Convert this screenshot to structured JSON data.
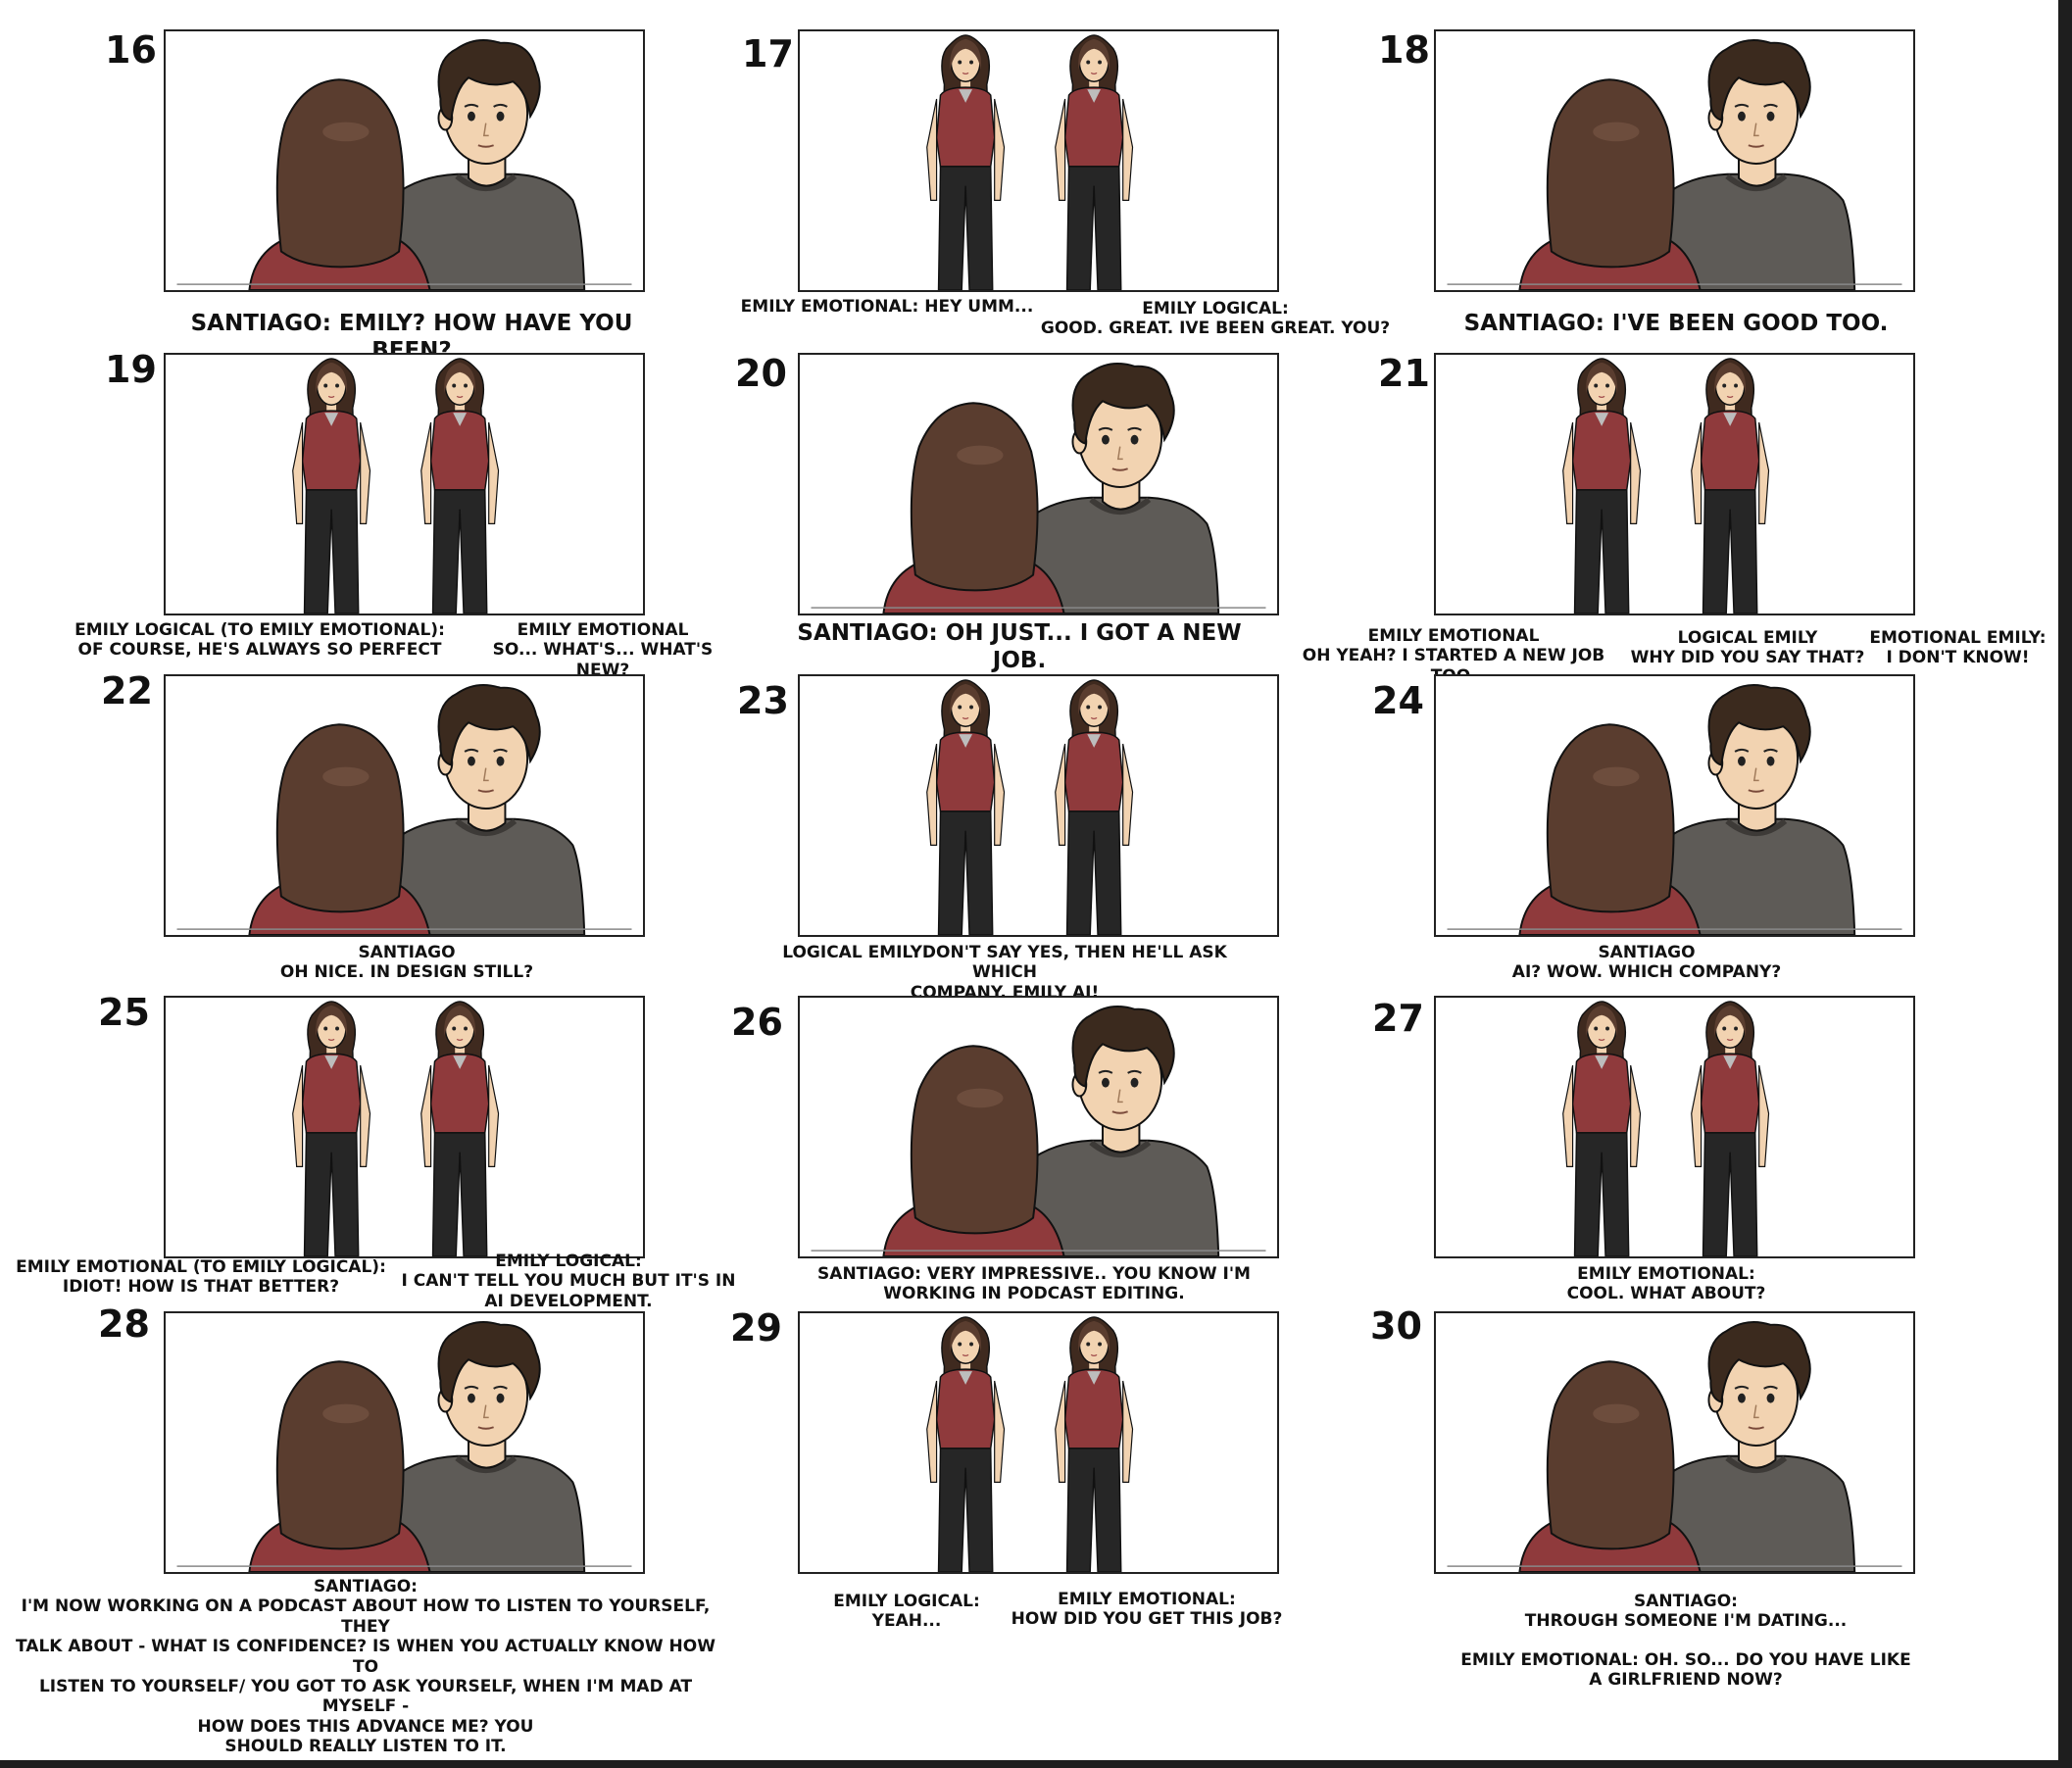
{
  "panels": [
    {
      "number": "16",
      "scene": "over-shoulder",
      "captions": [
        "SANTIAGO: EMILY? HOW HAVE YOU BEEN?"
      ]
    },
    {
      "number": "17",
      "scene": "two-emilys",
      "captions": [
        "EMILY EMOTIONAL: HEY UMM...",
        "EMILY LOGICAL:\nGOOD. GREAT. IVE BEEN GREAT. YOU?"
      ]
    },
    {
      "number": "18",
      "scene": "over-shoulder",
      "captions": [
        "SANTIAGO: I'VE BEEN GOOD TOO."
      ]
    },
    {
      "number": "19",
      "scene": "two-emilys",
      "captions": [
        "EMILY LOGICAL (TO EMILY EMOTIONAL):\nOF COURSE, HE'S ALWAYS SO PERFECT",
        "EMILY EMOTIONAL\nSO... WHAT'S... WHAT'S NEW?"
      ]
    },
    {
      "number": "20",
      "scene": "over-shoulder",
      "captions": [
        "SANTIAGO: OH JUST... I GOT A NEW\nJOB."
      ]
    },
    {
      "number": "21",
      "scene": "two-emilys",
      "captions": [
        "EMILY EMOTIONAL\nOH YEAH? I STARTED A NEW JOB TOO.",
        "LOGICAL EMILY\nWHY DID YOU SAY THAT?",
        "EMOTIONAL EMILY:\nI DON'T KNOW!"
      ]
    },
    {
      "number": "22",
      "scene": "over-shoulder",
      "captions": [
        "SANTIAGO\nOH NICE. IN DESIGN STILL?"
      ]
    },
    {
      "number": "23",
      "scene": "two-emilys",
      "captions": [
        "LOGICAL EMILYDON'T SAY YES, THEN HE'LL ASK WHICH\nCOMPANY.          EMILY AI!"
      ]
    },
    {
      "number": "24",
      "scene": "over-shoulder",
      "captions": [
        "SANTIAGO\nAI? WOW. WHICH COMPANY?"
      ]
    },
    {
      "number": "25",
      "scene": "two-emilys",
      "captions": [
        "EMILY EMOTIONAL (TO EMILY LOGICAL):\nIDIOT! HOW IS THAT BETTER?",
        "EMILY LOGICAL:\nI CAN'T TELL YOU MUCH BUT IT'S IN\nAI DEVELOPMENT."
      ]
    },
    {
      "number": "26",
      "scene": "over-shoulder",
      "captions": [
        "SANTIAGO: VERY IMPRESSIVE.. YOU KNOW I'M\nWORKING IN PODCAST EDITING."
      ]
    },
    {
      "number": "27",
      "scene": "two-emilys",
      "captions": [
        "EMILY EMOTIONAL:\nCOOL. WHAT ABOUT?"
      ]
    },
    {
      "number": "28",
      "scene": "over-shoulder",
      "captions": [
        "SANTIAGO:\nI'M NOW WORKING ON A PODCAST ABOUT HOW TO LISTEN TO YOURSELF, THEY\nTALK ABOUT - WHAT IS CONFIDENCE? IS WHEN YOU ACTUALLY KNOW HOW TO\nLISTEN TO YOURSELF/ YOU GOT TO ASK YOURSELF, WHEN I'M MAD AT MYSELF -\nHOW DOES THIS ADVANCE ME? YOU\nSHOULD REALLY LISTEN TO IT."
      ]
    },
    {
      "number": "29",
      "scene": "two-emilys",
      "captions": [
        "EMILY LOGICAL:\nYEAH...",
        "EMILY EMOTIONAL:\nHOW DID YOU GET THIS JOB?"
      ]
    },
    {
      "number": "30",
      "scene": "over-shoulder",
      "captions": [
        "SANTIAGO:\nTHROUGH SOMEONE I'M DATING...",
        "EMILY EMOTIONAL: OH. SO... DO YOU HAVE LIKE\nA GIRLFRIEND NOW?"
      ]
    }
  ],
  "colors": {
    "hair": "#5a3d2f",
    "hair_dark": "#3f2a1f",
    "santiago_hair": "#3b2a1e",
    "skin": "#f2d3b1",
    "shirt_grey": "#5e5b57",
    "shirt_red": "#8f3a3c",
    "pants": "#262626"
  }
}
